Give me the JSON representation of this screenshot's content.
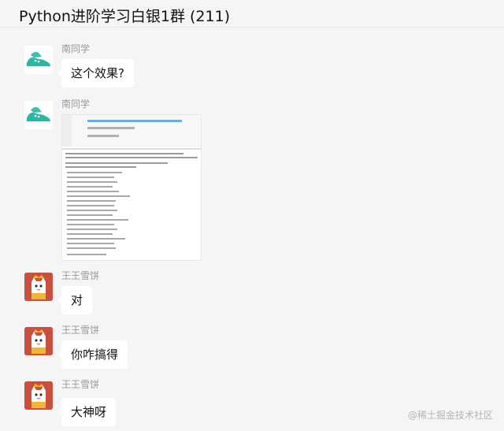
{
  "chat": {
    "title": "Python进阶学习白银1群 (211)"
  },
  "messages": [
    {
      "sender": "南同学",
      "text": "这个效果?"
    },
    {
      "sender": "南同学",
      "text": ""
    },
    {
      "sender": "王王雪饼",
      "text": "对"
    },
    {
      "sender": "王王雪饼",
      "text": "你咋搞得"
    },
    {
      "sender": "王王雪饼",
      "text": "大神呀"
    }
  ],
  "watermark": "@稀土掘金技术社区",
  "colors": {
    "background": "#f5f5f5",
    "bubble": "#ffffff",
    "sender_name": "#999999"
  }
}
